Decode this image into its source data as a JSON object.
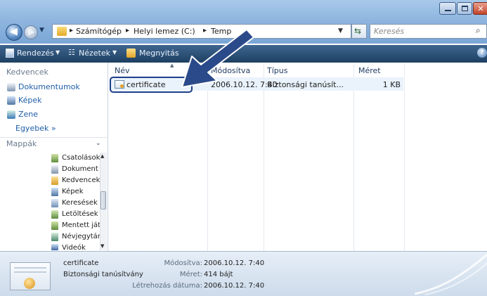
{
  "address": {
    "crumbs": [
      "Számítógép",
      "Helyi lemez (C:)",
      "Temp"
    ]
  },
  "search": {
    "placeholder": "Keresés"
  },
  "toolbar": {
    "organize": "Rendezés",
    "views": "Nézetek",
    "open": "Megnyitás"
  },
  "favorites": {
    "title": "Kedvencek",
    "items": [
      "Dokumentumok",
      "Képek",
      "Zene"
    ],
    "more": "Egyebek »"
  },
  "folders": {
    "title": "Mappák",
    "items": [
      "Csatolások",
      "Dokument",
      "Kedvencek",
      "Képek",
      "Keresések",
      "Letöltések",
      "Mentett ját",
      "Névjegytár",
      "Videók"
    ]
  },
  "columns": {
    "name": "Név",
    "modified": "Módosítva",
    "type": "Típus",
    "size": "Méret"
  },
  "files": [
    {
      "name": "certificate",
      "modified": "2006.10.12. 7:40",
      "type": "Biztonsági tanúsít...",
      "size": "1 KB"
    }
  ],
  "details": {
    "name": "certificate",
    "kind": "Biztonsági tanúsítvány",
    "modified_label": "Módosítva:",
    "modified_value": "2006.10.12. 7:40",
    "size_label": "Méret:",
    "size_value": "414 bájt",
    "created_label": "Létrehozás dátuma:",
    "created_value": "2006.10.12. 7:40"
  },
  "colors": {
    "accent": "#1f5ea8",
    "highlight_border": "#1c3f8a",
    "arrow": "#2b4a8a"
  }
}
